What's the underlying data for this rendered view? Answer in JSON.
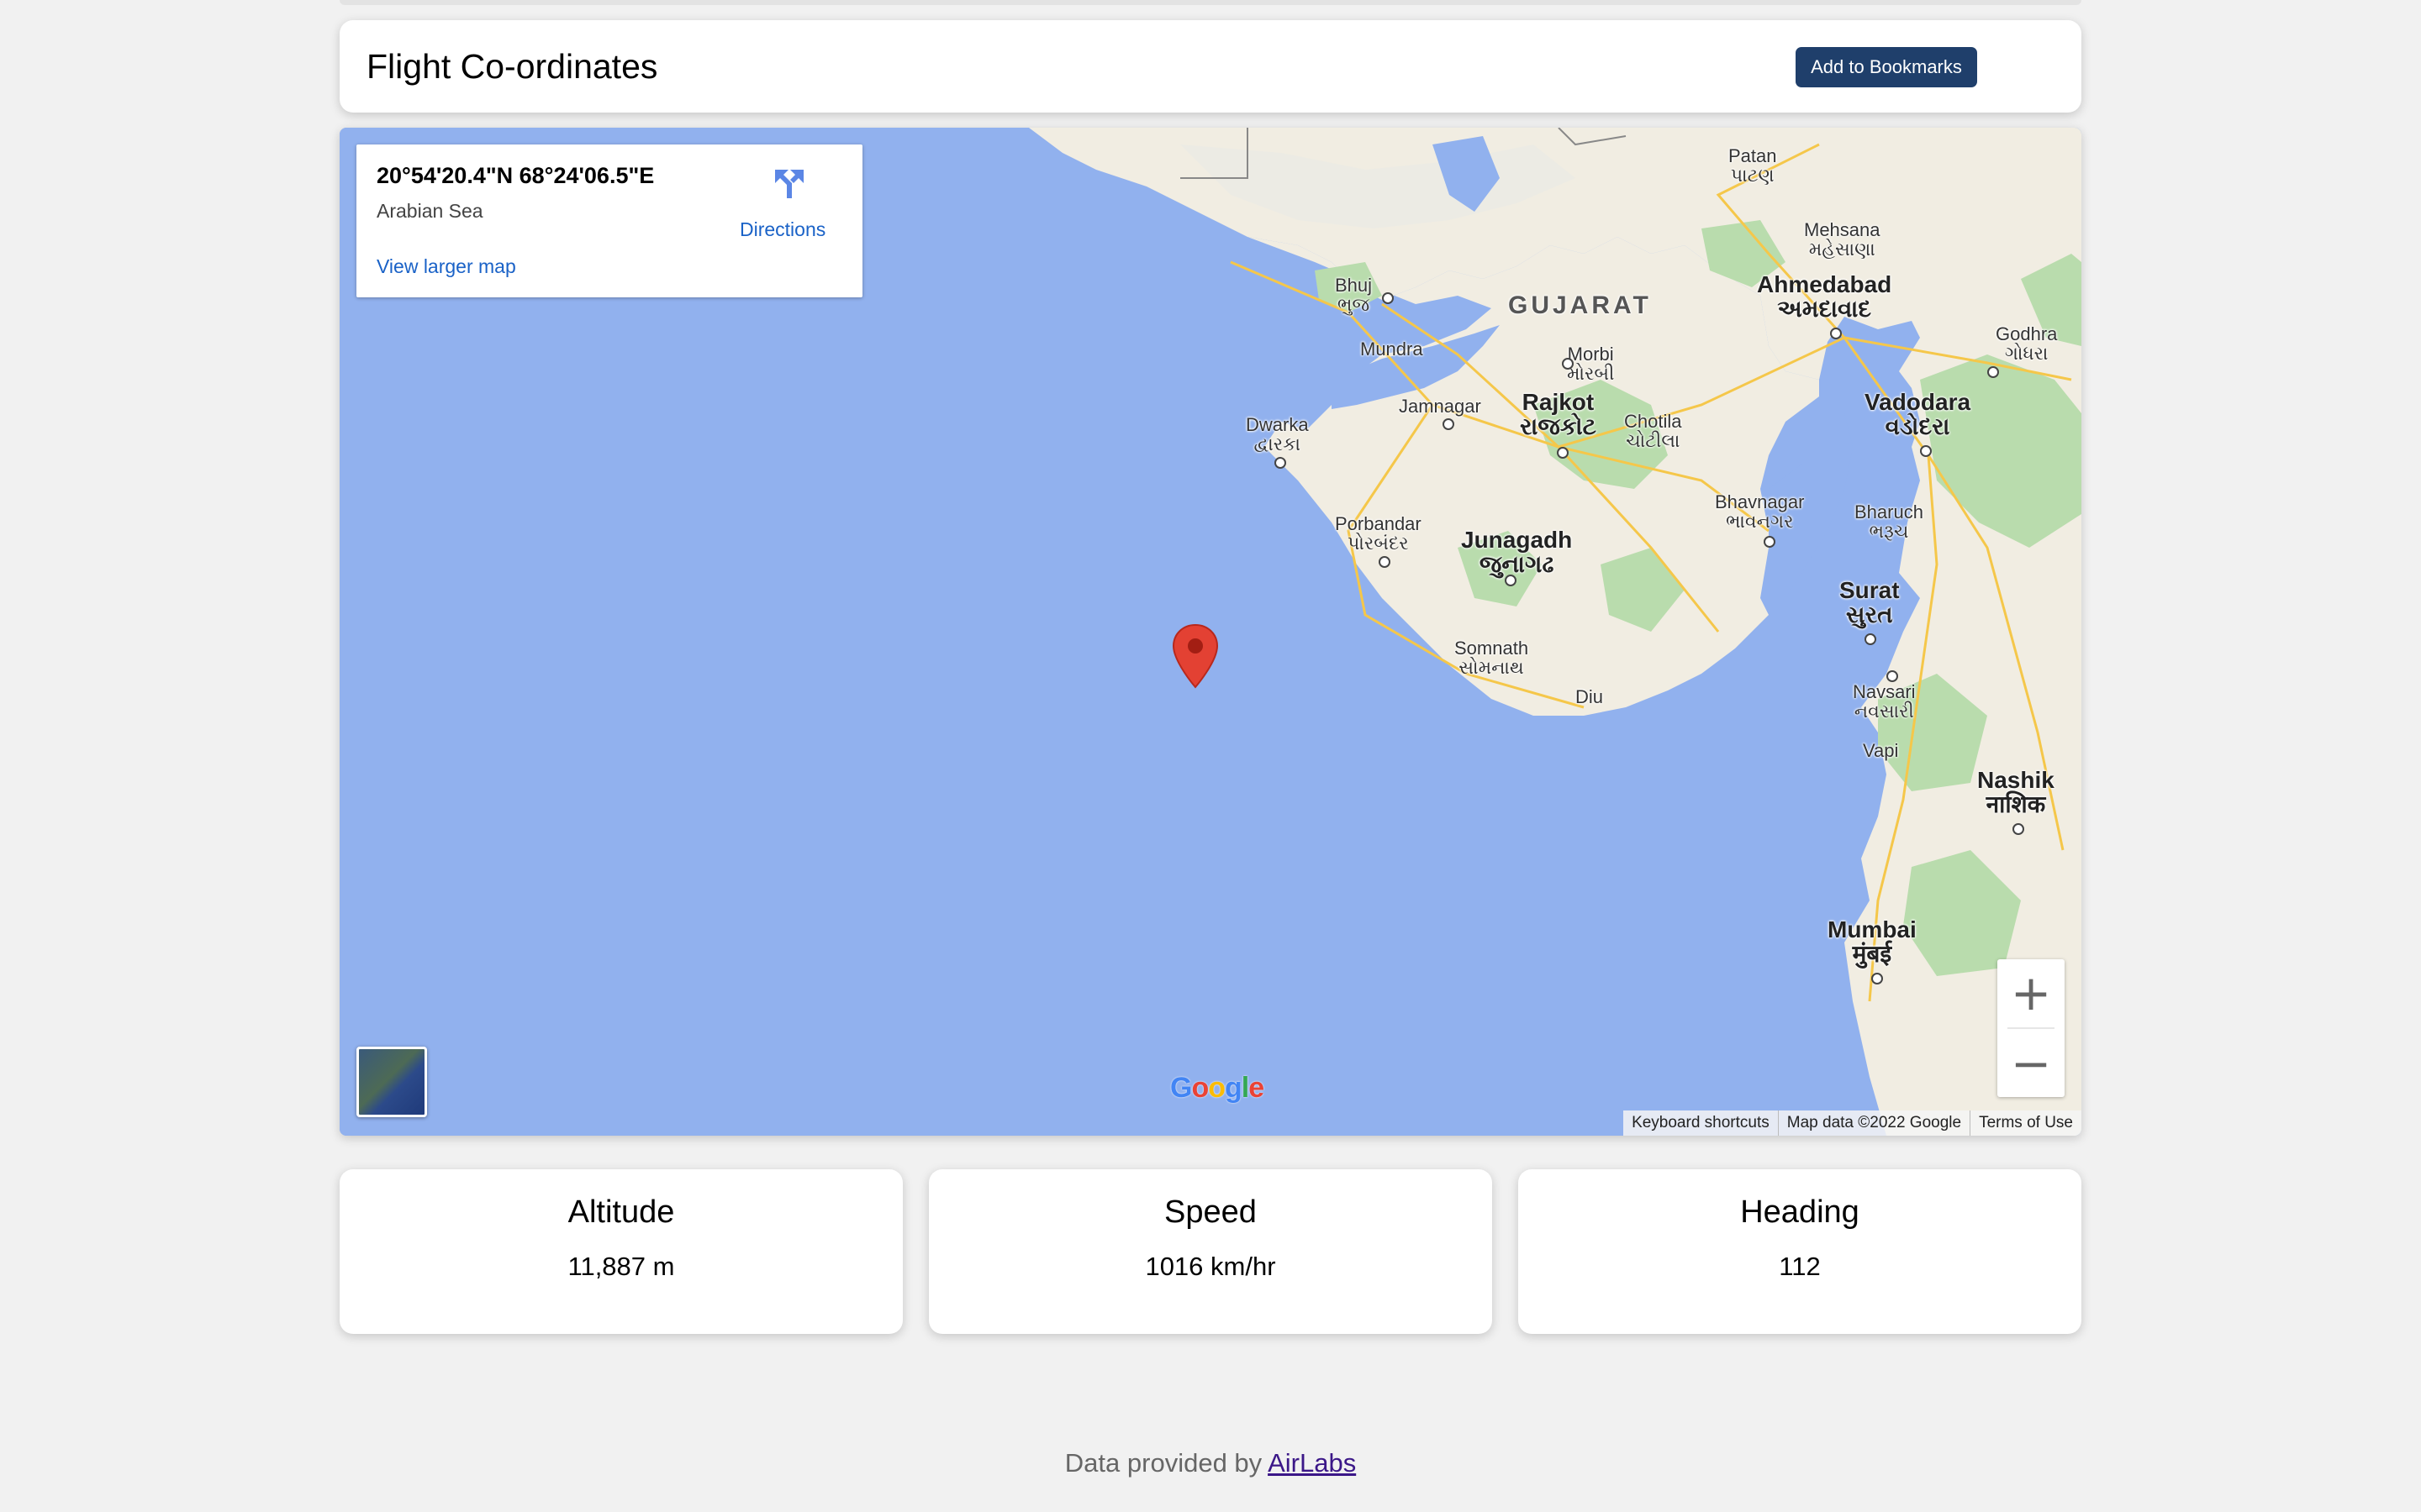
{
  "header": {
    "title": "Flight Co-ordinates",
    "bookmark_label": "Add to Bookmarks"
  },
  "map": {
    "infobox": {
      "coordinates": "20°54'20.4\"N 68°24'06.5\"E",
      "place": "Arabian Sea",
      "directions_label": "Directions",
      "larger_map_label": "View larger map"
    },
    "labels": {
      "state": "GUJARAT",
      "patan": "Patan",
      "patan_local": "પાટણ",
      "mehsana": "Mehsana",
      "mehsana_local": "મહેસાણા",
      "ahmedabad": "Ahmedabad",
      "ahmedabad_local": "અમદાવાદ",
      "bhuj": "Bhuj",
      "bhuj_local": "ભુજ",
      "mundra": "Mundra",
      "morbi": "Morbi",
      "morbi_local": "મોરબી",
      "godhra": "Godhra",
      "godhra_local": "ગોધરા",
      "jamnagar": "Jamnagar",
      "rajkot": "Rajkot",
      "rajkot_local": "રાજકોટ",
      "chotila": "Chotila",
      "chotila_local": "ચોટીલા",
      "dwarka": "Dwarka",
      "dwarka_local": "દ્વારકા",
      "vadodara": "Vadodara",
      "vadodara_local": "વડોદરા",
      "bhavnagar": "Bhavnagar",
      "bhavnagar_local": "ભાવનગર",
      "bharuch": "Bharuch",
      "bharuch_local": "ભરૂચ",
      "porbandar": "Porbandar",
      "porbandar_local": "પોરબંદર",
      "junagadh": "Junagadh",
      "junagadh_local": "જુનાગઢ",
      "surat": "Surat",
      "surat_local": "સુરત",
      "somnath": "Somnath",
      "somnath_local": "સોમનાથ",
      "diu": "Diu",
      "navsari": "Navsari",
      "navsari_local": "નવસારી",
      "vapi": "Vapi",
      "nashik": "Nashik",
      "nashik_local": "नाशिक",
      "mumbai": "Mumbai",
      "mumbai_local": "मुंबई"
    },
    "google_logo": "Google",
    "attribution": {
      "shortcuts": "Keyboard shortcuts",
      "map_data": "Map data ©2022 Google",
      "terms": "Terms of Use"
    },
    "zoom_in": "+",
    "zoom_out": "−"
  },
  "stats": [
    {
      "title": "Altitude",
      "value": "11,887 m"
    },
    {
      "title": "Speed",
      "value": "1016 km/hr"
    },
    {
      "title": "Heading",
      "value": "112"
    }
  ],
  "footer": {
    "prefix": "Data provided by",
    "link_label": "AirLabs"
  },
  "colors": {
    "sea": "#91b1ee",
    "land": "#f1ede2",
    "vegetation": "#b9dcad",
    "button": "#1f3f6b",
    "link": "#1a62c7",
    "pin": "#e34133"
  }
}
